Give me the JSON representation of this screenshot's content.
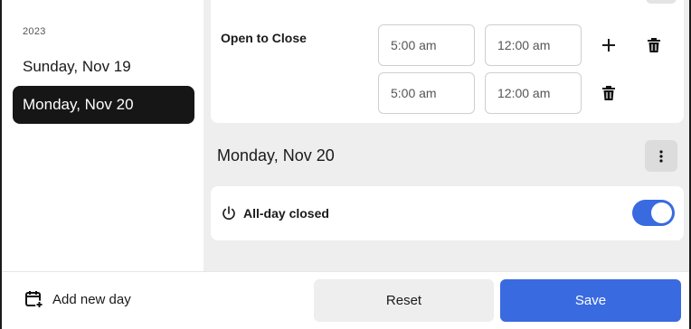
{
  "sidebar": {
    "year": "2023",
    "days": [
      {
        "label": "Sunday, Nov 19",
        "active": false
      },
      {
        "label": "Monday, Nov 20",
        "active": true
      }
    ]
  },
  "schedule": {
    "slot_label": "Open to Close",
    "slots": [
      {
        "open": "5:00 am",
        "close": "12:00 am"
      },
      {
        "open": "5:00 am",
        "close": "12:00 am"
      }
    ],
    "icons": {
      "add": "plus-icon",
      "delete": "trash-icon",
      "menu": "kebab-icon",
      "power": "power-icon",
      "calendar": "calendar-plus-icon"
    }
  },
  "day_section": {
    "heading": "Monday, Nov 20",
    "closed_label": "All-day closed",
    "closed_enabled": true
  },
  "footer": {
    "add_day_label": "Add new day",
    "reset_label": "Reset",
    "save_label": "Save"
  },
  "colors": {
    "accent": "#3a6ae0",
    "active_day_bg": "#161616",
    "panel_bg": "#eeeeee"
  }
}
